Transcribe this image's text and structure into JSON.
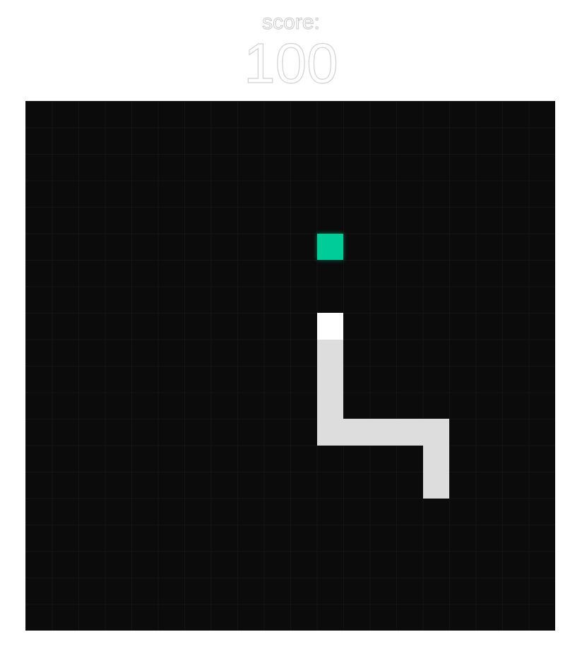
{
  "score": {
    "label": "score:",
    "value": "100"
  },
  "board": {
    "columns": 20,
    "rows": 20,
    "background": "#0b0b0b",
    "grid_line": "#151515"
  },
  "food": {
    "col": 11,
    "row": 5,
    "color": "#00cc99"
  },
  "snake": {
    "head_color": "#ffffff",
    "body_color": "#dddddd",
    "segments": [
      {
        "col": 11,
        "row": 8
      },
      {
        "col": 11,
        "row": 9
      },
      {
        "col": 11,
        "row": 10
      },
      {
        "col": 11,
        "row": 11
      },
      {
        "col": 11,
        "row": 12
      },
      {
        "col": 12,
        "row": 12
      },
      {
        "col": 13,
        "row": 12
      },
      {
        "col": 14,
        "row": 12
      },
      {
        "col": 15,
        "row": 12
      },
      {
        "col": 15,
        "row": 13
      },
      {
        "col": 15,
        "row": 14
      }
    ]
  }
}
